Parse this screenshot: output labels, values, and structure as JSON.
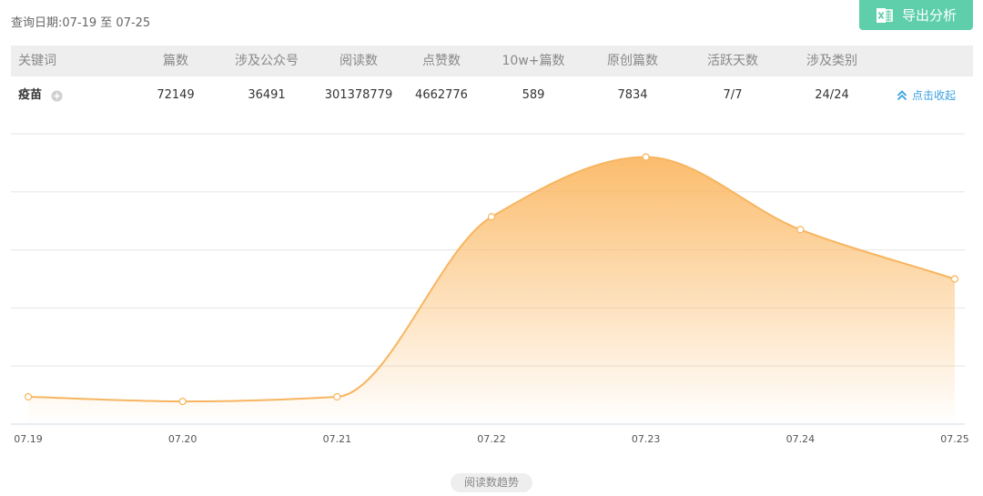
{
  "query": {
    "date_label": "查询日期:",
    "date_range": "07-19 至 07-25"
  },
  "export_button": {
    "label": "导出分析",
    "icon": "excel-icon",
    "color": "#5ecfaa"
  },
  "table": {
    "headers": [
      "关键词",
      "篇数",
      "涉及公众号",
      "阅读数",
      "点赞数",
      "10w+篇数",
      "原创篇数",
      "活跃天数",
      "涉及类别"
    ],
    "row": {
      "keyword": "疫苗",
      "expand_icon": "plus-circle-icon",
      "values": [
        "72149",
        "36491",
        "301378779",
        "4662776",
        "589",
        "7834",
        "7/7",
        "24/24"
      ]
    },
    "collapse_link": {
      "label": "点击收起",
      "icon": "double-chevron-up-icon",
      "color": "#39a0e0"
    }
  },
  "chart_data": {
    "type": "area",
    "title": "阅读数趋势",
    "categories": [
      "07.19",
      "07.20",
      "07.21",
      "07.22",
      "07.23",
      "07.24",
      "07.25"
    ],
    "values": [
      0.47,
      0.39,
      0.47,
      3.57,
      4.6,
      3.35,
      2.5
    ],
    "ylim": [
      0,
      5
    ],
    "y_ticks_shown": false,
    "grid": true,
    "line_color": "#f7b560",
    "fill_color": "#fbb965"
  }
}
